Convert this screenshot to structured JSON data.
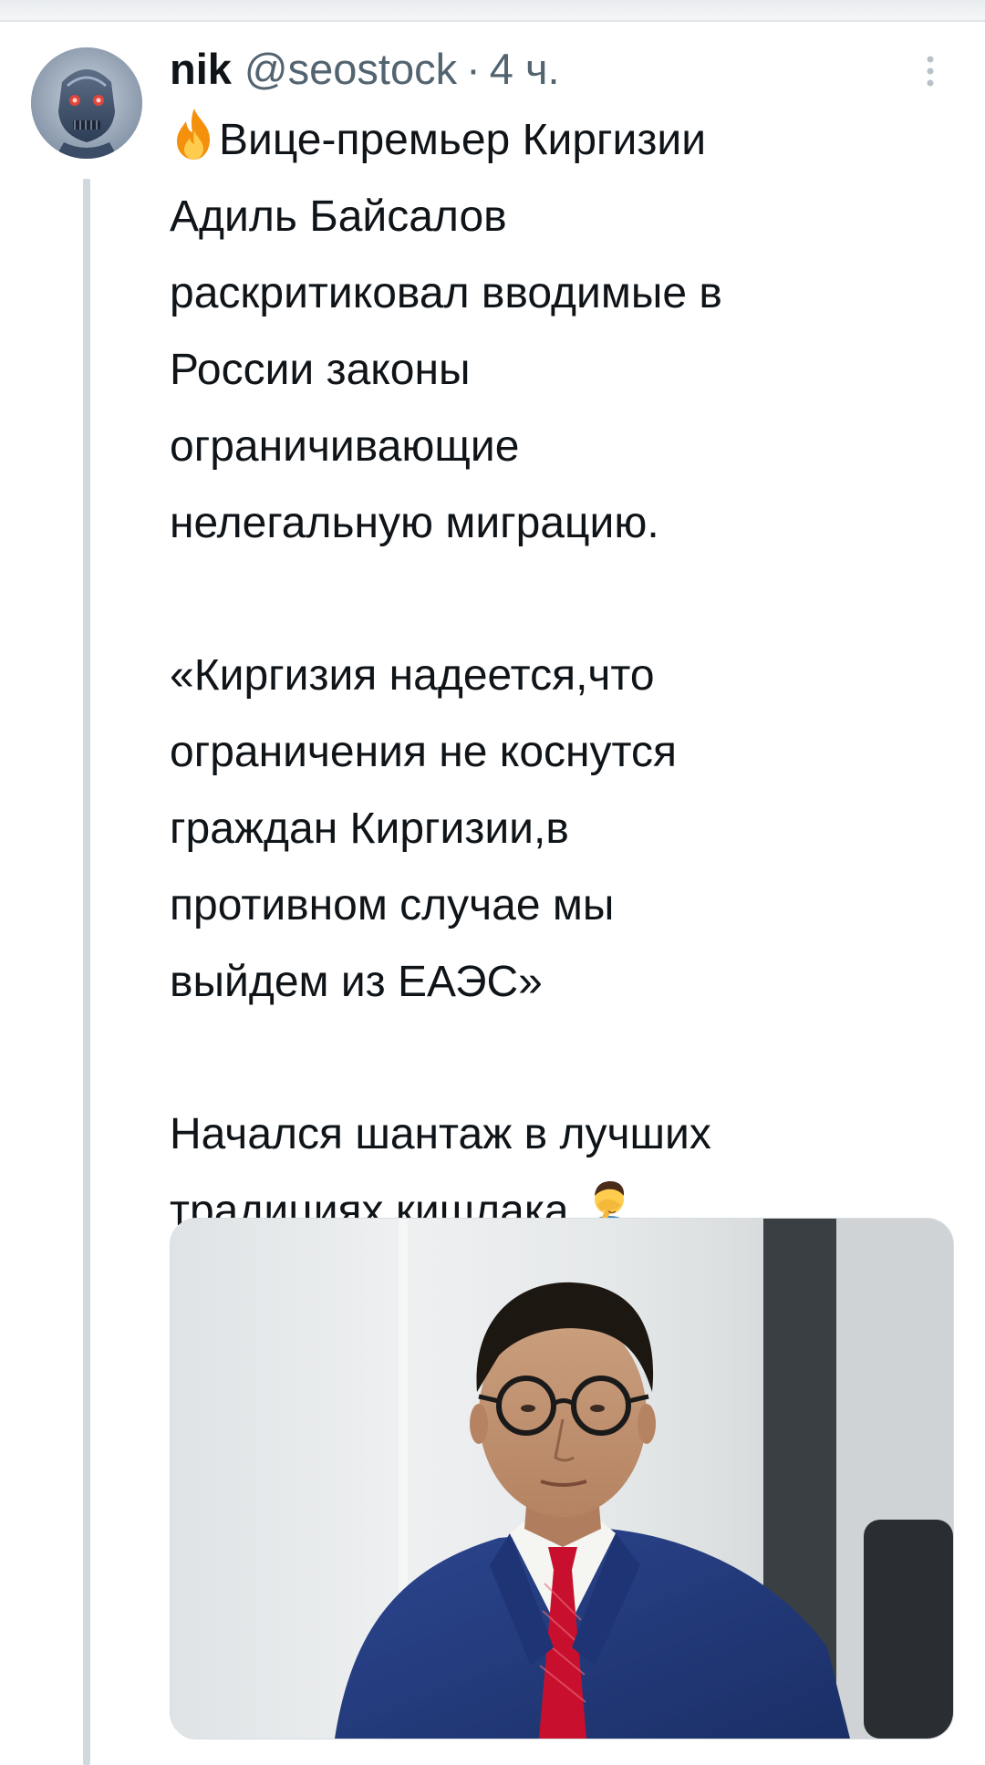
{
  "tweet": {
    "display_name": "nik",
    "handle": "@seostock",
    "separator": "·",
    "time": "4 ч.",
    "avatar_icon": "terminator-avatar-icon",
    "more_icon": "more-vertical-icon",
    "text": {
      "lines": [
        "Вице-премьер Киргизии",
        "Адиль Байсалов",
        "раскритиковал вводимые в",
        "России законы",
        "ограничивающие",
        "нелегальную миграцию.",
        "«Киргизия надеется,что",
        "ограничения не коснутся",
        "граждан Киргизии,в",
        "противном случае мы",
        "выйдем из ЕАЭС»",
        "Начался шантаж в лучших",
        "традициях кишлака."
      ],
      "leading_emoji": "fire-emoji",
      "trailing_emoji": "facepalm-emoji"
    },
    "media": {
      "type": "photo",
      "subject": "man-in-suit-with-glasses-photo"
    }
  },
  "colors": {
    "text": "#0f1419",
    "secondary": "#536471",
    "thread_line": "#cfd9de",
    "suit": "#243a78",
    "tie": "#c8102e"
  }
}
